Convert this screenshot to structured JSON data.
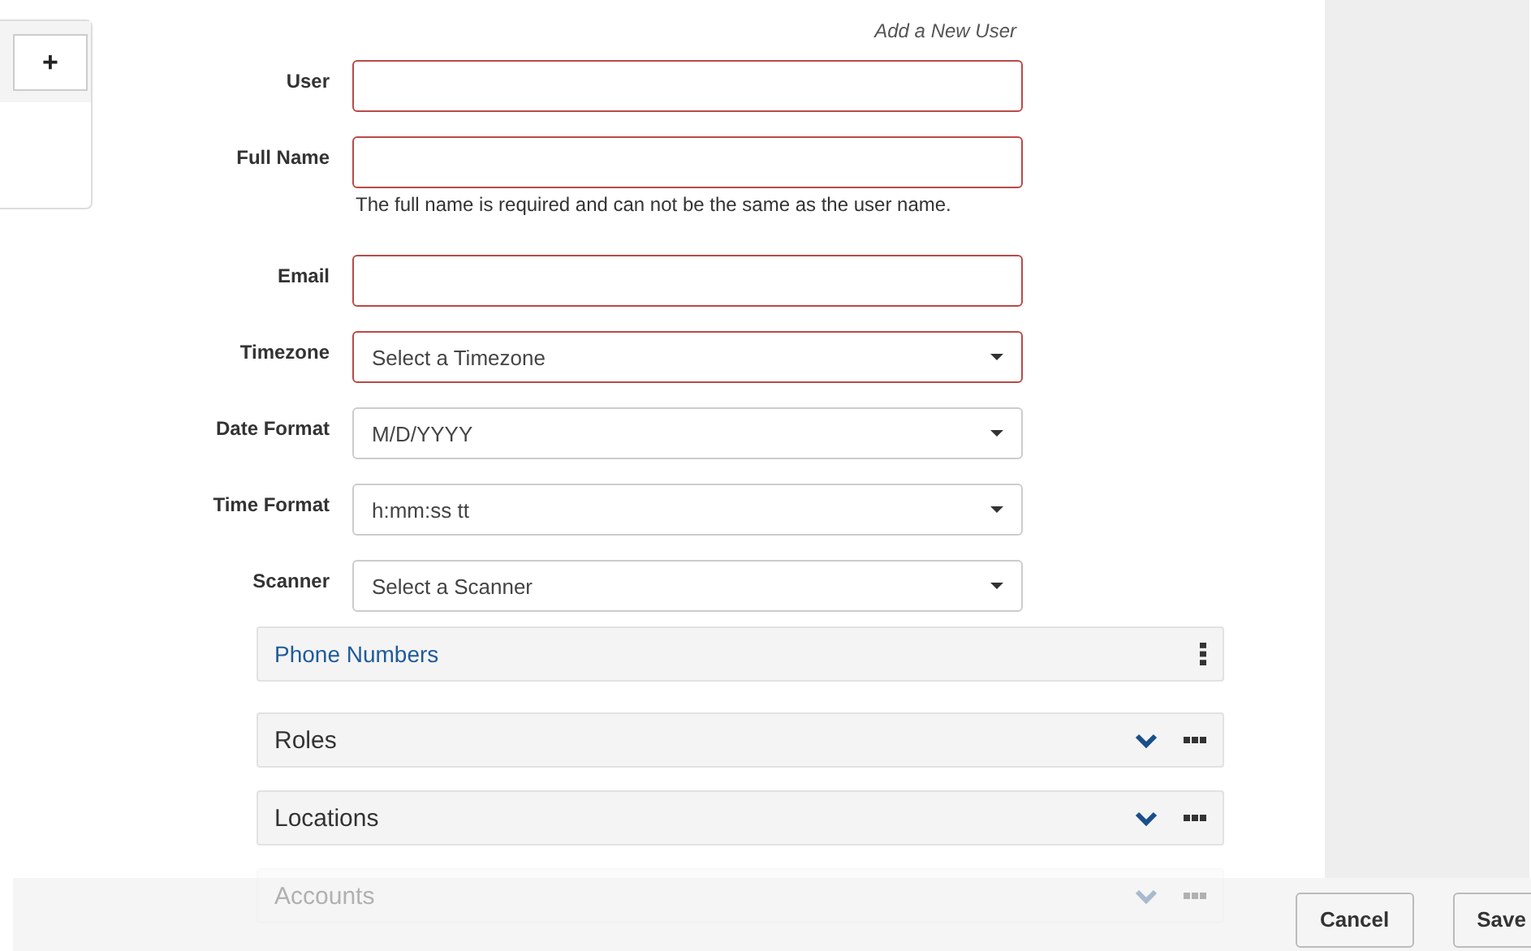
{
  "sidebar": {
    "add_button": "+"
  },
  "form": {
    "title": "Add a New User",
    "fields": [
      {
        "label": "User",
        "kind": "text",
        "invalid": true
      },
      {
        "label": "Full Name",
        "kind": "text",
        "invalid": true,
        "hint": "The full name is required and can not be the same as the user name."
      },
      {
        "label": "Email",
        "kind": "text",
        "invalid": true
      },
      {
        "label": "Timezone",
        "kind": "select",
        "invalid": true,
        "placeholder": "Select a Timezone"
      },
      {
        "label": "Date Format",
        "kind": "select",
        "invalid": false,
        "value": "M/D/YYYY"
      },
      {
        "label": "Time Format",
        "kind": "select",
        "invalid": false,
        "value": "h:mm:ss tt"
      },
      {
        "label": "Scanner",
        "kind": "select",
        "invalid": false,
        "placeholder": "Select a Scanner"
      }
    ]
  },
  "panels": [
    {
      "title": "Phone Numbers",
      "kind": "list",
      "dimmed": false
    },
    {
      "title": "Roles",
      "kind": "collapsible",
      "dimmed": false
    },
    {
      "title": "Locations",
      "kind": "collapsible",
      "dimmed": false
    },
    {
      "title": "Accounts",
      "kind": "collapsible",
      "dimmed": true
    }
  ],
  "footer": {
    "buttons": [
      "Cancel",
      "Save"
    ]
  }
}
